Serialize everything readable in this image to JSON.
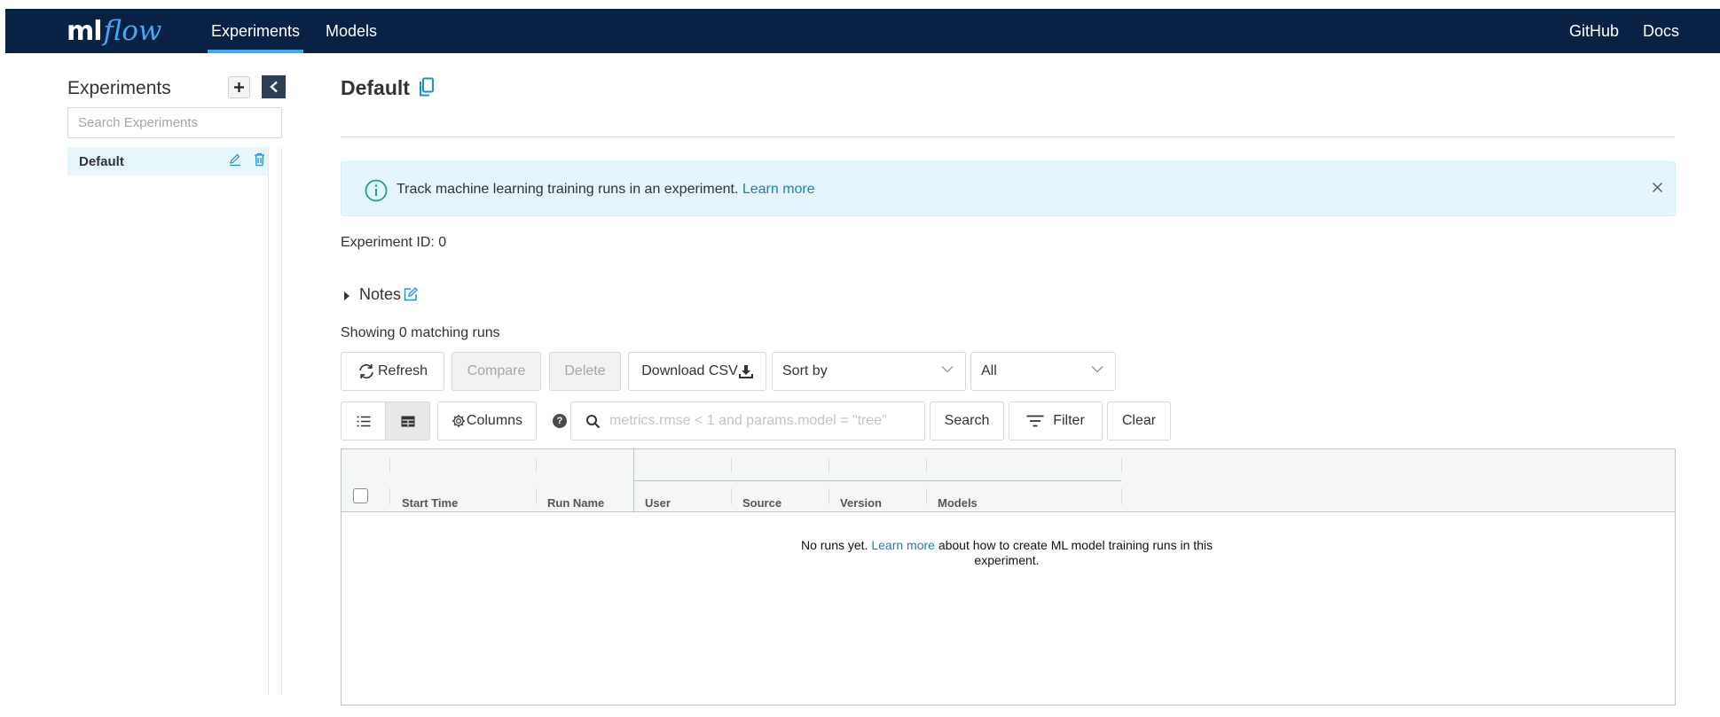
{
  "header": {
    "logo_ml": "ml",
    "logo_flow": "flow",
    "nav": {
      "experiments": "Experiments",
      "models": "Models",
      "github": "GitHub",
      "docs": "Docs"
    },
    "accent_color": "#43a8f5",
    "background_color": "#082145"
  },
  "sidebar": {
    "title": "Experiments",
    "search_placeholder": "Search Experiments",
    "items": [
      {
        "label": "Default",
        "selected": true
      }
    ]
  },
  "main": {
    "title": "Default",
    "alert": {
      "text": "Track machine learning training runs in an experiment.",
      "link": "Learn more"
    },
    "experiment_id_label": "Experiment ID:",
    "experiment_id_value": "0",
    "notes_label": "Notes",
    "showing_text": "Showing 0 matching runs",
    "toolbar": {
      "refresh": "Refresh",
      "compare": "Compare",
      "delete": "Delete",
      "download_csv": "Download CSV",
      "sort_by": "Sort by",
      "lifecycle": "All",
      "columns": "Columns",
      "search_placeholder": "metrics.rmse < 1 and params.model = \"tree\"",
      "search": "Search",
      "filter": "Filter",
      "clear": "Clear"
    },
    "table": {
      "columns": [
        "Start Time",
        "Run Name",
        "User",
        "Source",
        "Version",
        "Models"
      ],
      "empty_text_before": "No runs yet.",
      "empty_link": "Learn more",
      "empty_text_after": "about how to create ML model training runs in this experiment."
    }
  }
}
